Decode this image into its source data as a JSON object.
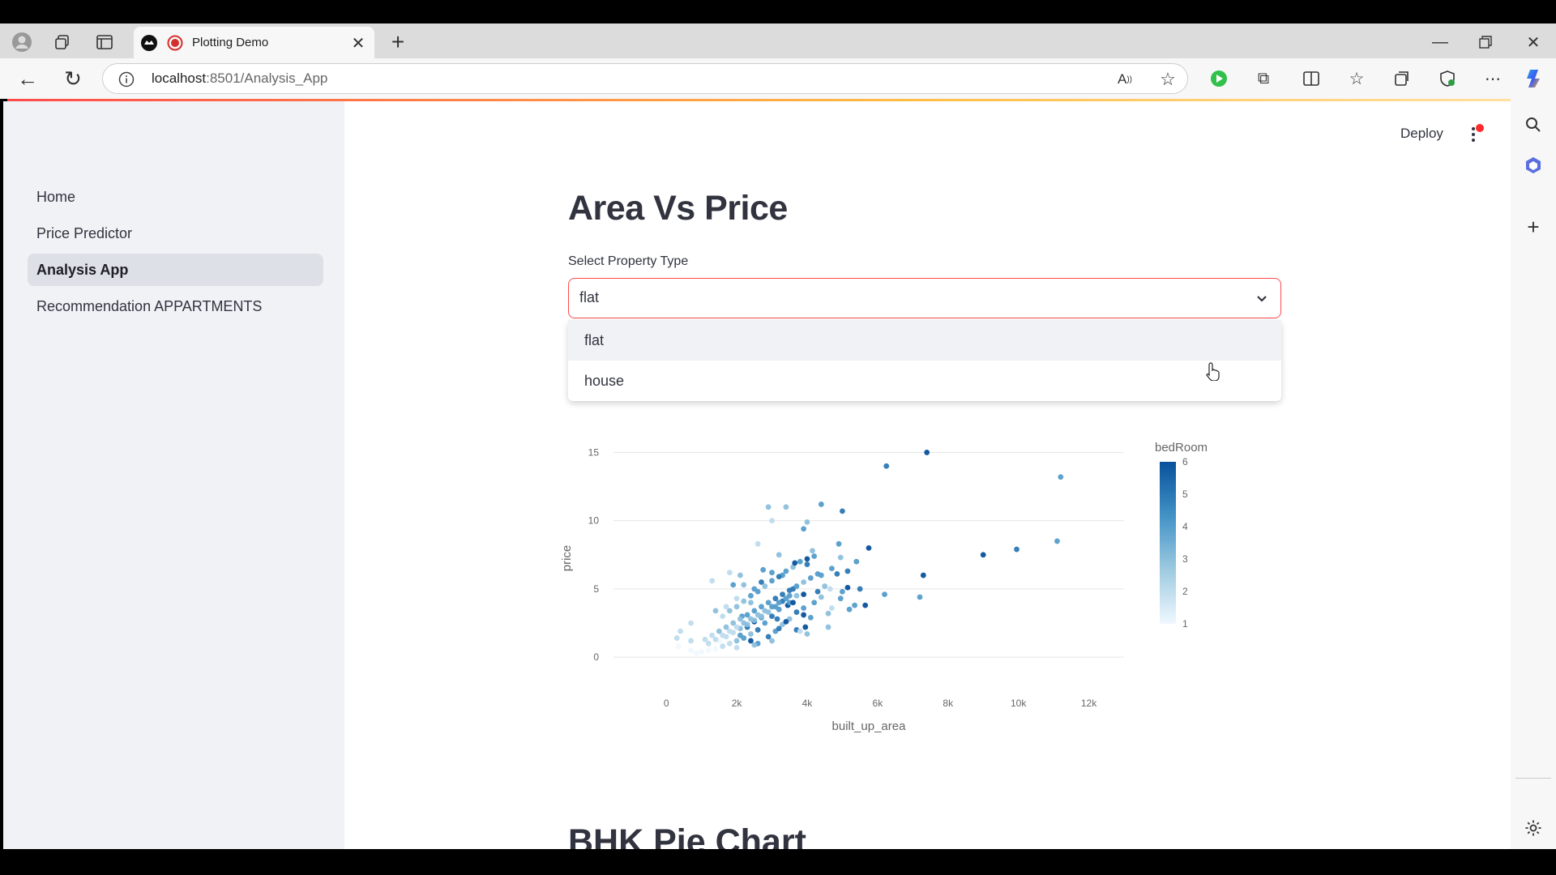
{
  "browser": {
    "tab_title": "Plotting Demo",
    "url_host": "localhost",
    "url_rest": ":8501/Analysis_App",
    "accent": "#ff4b4b"
  },
  "sidebar": {
    "items": [
      {
        "label": "Home",
        "active": false
      },
      {
        "label": "Price Predictor",
        "active": false
      },
      {
        "label": "Analysis App",
        "active": true
      },
      {
        "label": "Recommendation APPARTMENTS",
        "active": false
      }
    ]
  },
  "header": {
    "deploy_label": "Deploy"
  },
  "main": {
    "title": "Area Vs Price",
    "select_label": "Select Property Type",
    "select_value": "flat",
    "options": [
      "flat",
      "house"
    ],
    "next_section_title": "BHK Pie Chart"
  },
  "chart_data": {
    "type": "scatter",
    "xlabel": "built_up_area",
    "ylabel": "price",
    "color_label": "bedRoom",
    "xlim": [
      -1500,
      13000
    ],
    "ylim": [
      -1,
      15.5
    ],
    "x_ticks": [
      "0",
      "2k",
      "4k",
      "6k",
      "8k",
      "10k",
      "12k"
    ],
    "x_tick_values": [
      0,
      2000,
      4000,
      6000,
      8000,
      10000,
      12000
    ],
    "y_ticks": [
      "0",
      "5",
      "10",
      "15"
    ],
    "y_tick_values": [
      0,
      5,
      10,
      15
    ],
    "color_ticks": [
      "6",
      "5",
      "4",
      "3",
      "2",
      "1"
    ],
    "colorscale": [
      "#f0f8ff",
      "#9ecae1",
      "#4292c6",
      "#08519c"
    ],
    "points": [
      [
        6250,
        14.0,
        5
      ],
      [
        7400,
        15.0,
        6
      ],
      [
        11200,
        13.2,
        4
      ],
      [
        9000,
        7.5,
        6
      ],
      [
        9950,
        7.9,
        5
      ],
      [
        11100,
        8.5,
        4
      ],
      [
        7300,
        6.0,
        6
      ],
      [
        7200,
        4.4,
        4
      ],
      [
        5750,
        8.0,
        6
      ],
      [
        6200,
        4.6,
        4
      ],
      [
        5650,
        3.8,
        6
      ],
      [
        5000,
        10.7,
        5
      ],
      [
        4400,
        11.2,
        4
      ],
      [
        3400,
        11.0,
        3
      ],
      [
        2900,
        11.0,
        3
      ],
      [
        3000,
        10.0,
        2
      ],
      [
        3900,
        9.4,
        4
      ],
      [
        4000,
        9.9,
        3
      ],
      [
        4150,
        7.8,
        3
      ],
      [
        4000,
        7.2,
        6
      ],
      [
        4900,
        8.3,
        4
      ],
      [
        4950,
        7.3,
        3
      ],
      [
        4850,
        6.1,
        5
      ],
      [
        5150,
        6.3,
        5
      ],
      [
        5400,
        7.0,
        4
      ],
      [
        5150,
        5.1,
        6
      ],
      [
        5500,
        5.0,
        5
      ],
      [
        5000,
        4.8,
        4
      ],
      [
        4500,
        5.2,
        3
      ],
      [
        4300,
        4.8,
        5
      ],
      [
        4650,
        5.0,
        2
      ],
      [
        4950,
        4.3,
        4
      ],
      [
        5350,
        3.8,
        4
      ],
      [
        4600,
        3.2,
        3
      ],
      [
        4100,
        2.9,
        4
      ],
      [
        3950,
        2.2,
        6
      ],
      [
        3700,
        2.0,
        5
      ],
      [
        3450,
        3.8,
        6
      ],
      [
        4600,
        2.2,
        3
      ],
      [
        3900,
        3.1,
        6
      ],
      [
        2600,
        8.3,
        2
      ],
      [
        1300,
        5.6,
        2
      ],
      [
        1400,
        3.4,
        3
      ],
      [
        1700,
        3.7,
        2
      ],
      [
        2150,
        3.0,
        4
      ],
      [
        2400,
        4.0,
        3
      ],
      [
        2750,
        6.4,
        4
      ],
      [
        3200,
        7.5,
        3
      ],
      [
        2100,
        6.0,
        3
      ],
      [
        1800,
        6.2,
        2
      ],
      [
        1900,
        5.3,
        4
      ],
      [
        2000,
        4.3,
        2
      ],
      [
        2200,
        5.3,
        3
      ],
      [
        2500,
        5.0,
        4
      ],
      [
        2700,
        5.5,
        5
      ],
      [
        3000,
        6.2,
        4
      ],
      [
        3300,
        6.0,
        4
      ],
      [
        3600,
        5.0,
        5
      ],
      [
        3700,
        4.5,
        3
      ],
      [
        3500,
        4.0,
        4
      ],
      [
        3200,
        3.5,
        4
      ],
      [
        3000,
        3.0,
        5
      ],
      [
        2800,
        2.5,
        4
      ],
      [
        2600,
        2.0,
        5
      ],
      [
        2400,
        1.7,
        3
      ],
      [
        2200,
        1.4,
        4
      ],
      [
        2000,
        1.2,
        3
      ],
      [
        1800,
        1.0,
        2
      ],
      [
        1600,
        0.8,
        2
      ],
      [
        1400,
        0.6,
        1
      ],
      [
        1200,
        0.5,
        1
      ],
      [
        1000,
        0.4,
        1
      ],
      [
        850,
        0.3,
        1
      ],
      [
        700,
        0.5,
        1
      ],
      [
        700,
        1.2,
        2
      ],
      [
        700,
        2.5,
        2
      ],
      [
        350,
        0.8,
        1
      ],
      [
        300,
        1.4,
        2
      ],
      [
        400,
        1.9,
        2
      ],
      [
        1100,
        1.3,
        2
      ],
      [
        1300,
        1.6,
        2
      ],
      [
        1500,
        1.9,
        3
      ],
      [
        1700,
        2.2,
        3
      ],
      [
        1900,
        2.5,
        3
      ],
      [
        2100,
        2.8,
        3
      ],
      [
        2300,
        3.1,
        4
      ],
      [
        2500,
        3.4,
        4
      ],
      [
        2700,
        3.7,
        4
      ],
      [
        2900,
        4.0,
        4
      ],
      [
        3100,
        4.3,
        5
      ],
      [
        3300,
        4.6,
        5
      ],
      [
        3500,
        4.9,
        5
      ],
      [
        3700,
        5.2,
        4
      ],
      [
        3900,
        5.5,
        3
      ],
      [
        4100,
        5.8,
        4
      ],
      [
        4300,
        6.1,
        4
      ],
      [
        1600,
        3.0,
        2
      ],
      [
        1800,
        3.4,
        3
      ],
      [
        2000,
        3.7,
        3
      ],
      [
        2200,
        4.1,
        3
      ],
      [
        2400,
        4.5,
        4
      ],
      [
        2600,
        4.8,
        4
      ],
      [
        2800,
        5.2,
        3
      ],
      [
        3000,
        5.6,
        4
      ],
      [
        3200,
        5.9,
        5
      ],
      [
        3400,
        6.3,
        4
      ],
      [
        3600,
        6.6,
        3
      ],
      [
        3800,
        7.0,
        4
      ],
      [
        4000,
        6.8,
        5
      ],
      [
        4200,
        7.4,
        4
      ],
      [
        4400,
        6.0,
        4
      ],
      [
        4700,
        6.5,
        4
      ],
      [
        2300,
        2.2,
        5
      ],
      [
        2500,
        2.6,
        6
      ],
      [
        2700,
        2.9,
        4
      ],
      [
        2900,
        3.3,
        3
      ],
      [
        3100,
        3.7,
        4
      ],
      [
        3300,
        4.1,
        5
      ],
      [
        3500,
        4.5,
        4
      ],
      [
        1500,
        1.2,
        1
      ],
      [
        1700,
        1.5,
        2
      ],
      [
        1900,
        1.8,
        2
      ],
      [
        2100,
        2.1,
        3
      ],
      [
        2300,
        2.4,
        3
      ],
      [
        2500,
        2.7,
        3
      ],
      [
        2700,
        3.0,
        3
      ],
      [
        1200,
        1.0,
        2
      ],
      [
        1400,
        1.3,
        2
      ],
      [
        1600,
        1.6,
        2
      ],
      [
        1800,
        1.9,
        2
      ],
      [
        2000,
        2.2,
        2
      ],
      [
        2200,
        2.5,
        3
      ],
      [
        2400,
        2.8,
        3
      ],
      [
        2600,
        3.1,
        3
      ],
      [
        2800,
        3.4,
        3
      ],
      [
        3000,
        3.7,
        4
      ],
      [
        3200,
        4.0,
        4
      ],
      [
        3400,
        4.3,
        4
      ],
      [
        2100,
        1.6,
        4
      ],
      [
        2400,
        1.2,
        6
      ],
      [
        2900,
        1.5,
        5
      ],
      [
        3100,
        1.9,
        4
      ],
      [
        3300,
        2.4,
        3
      ],
      [
        3500,
        2.8,
        3
      ],
      [
        3700,
        3.3,
        5
      ],
      [
        3900,
        3.6,
        4
      ],
      [
        4200,
        4.0,
        4
      ],
      [
        4400,
        4.4,
        3
      ],
      [
        4700,
        3.6,
        2
      ],
      [
        5200,
        3.5,
        4
      ],
      [
        3800,
        1.9,
        2
      ],
      [
        4000,
        1.7,
        3
      ],
      [
        3200,
        2.1,
        5
      ],
      [
        2600,
        1.0,
        4
      ],
      [
        3000,
        1.2,
        3
      ],
      [
        2000,
        0.7,
        2
      ],
      [
        2500,
        0.9,
        3
      ],
      [
        3600,
        4.0,
        6
      ],
      [
        3900,
        4.6,
        6
      ],
      [
        3400,
        2.6,
        6
      ],
      [
        3150,
        2.8,
        5
      ],
      [
        3650,
        6.9,
        6
      ]
    ]
  }
}
